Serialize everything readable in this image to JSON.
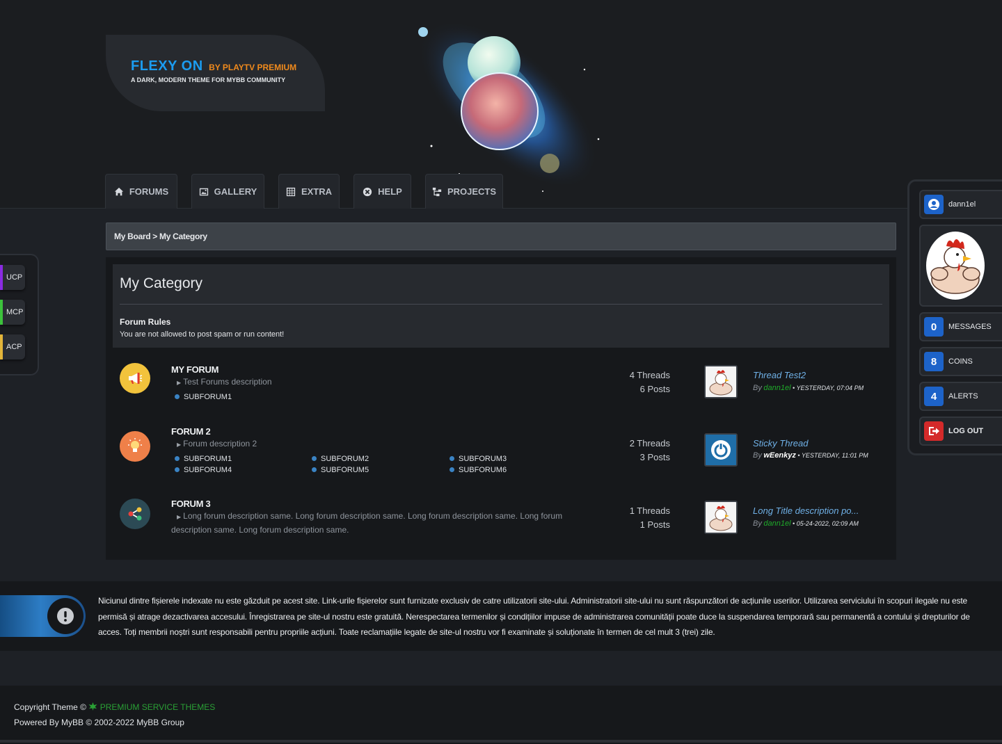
{
  "header": {
    "logo_main": "FLEXY ON",
    "logo_by": "BY PLAYTV PREMIUM",
    "logo_tagline": "A DARK, MODERN THEME FOR MYBB COMMUNITY"
  },
  "nav": {
    "tabs": [
      {
        "label": "FORUMS",
        "icon": "home-icon"
      },
      {
        "label": "GALLERY",
        "icon": "image-icon"
      },
      {
        "label": "EXTRA",
        "icon": "grid-icon"
      },
      {
        "label": "HELP",
        "icon": "help-icon"
      },
      {
        "label": "PROJECTS",
        "icon": "sitemap-icon"
      }
    ]
  },
  "left_panel": {
    "items": [
      {
        "label": "UCP",
        "color": "#8a2be2"
      },
      {
        "label": "MCP",
        "color": "#3cc23c"
      },
      {
        "label": "ACP",
        "color": "#e3b53a"
      }
    ]
  },
  "breadcrumb": {
    "root": "My Board",
    "separator": ">",
    "current": "My Category"
  },
  "category": {
    "title": "My Category",
    "rules_title": "Forum Rules",
    "rules_text": "You are not allowed to post spam or run content!",
    "forums": [
      {
        "name": "MY FORUM",
        "description": "Test Forums description",
        "icon": "megaphone-icon",
        "icon_color": "#f2c33c",
        "subforums": [
          "SUBFORUM1"
        ],
        "threads": "4 Threads",
        "posts": "6 Posts",
        "last_title": "Thread Test2",
        "last_by": "By",
        "last_user": "dann1el",
        "last_date": "• YESTERDAY, 07:04 PM"
      },
      {
        "name": "FORUM 2",
        "description": "Forum description 2",
        "icon": "lightbulb-icon",
        "icon_color": "#ef8049",
        "subforums": [
          "SUBFORUM1",
          "SUBFORUM2",
          "SUBFORUM3",
          "SUBFORUM4",
          "SUBFORUM5",
          "SUBFORUM6"
        ],
        "threads": "2 Threads",
        "posts": "3 Posts",
        "last_title": "Sticky Thread",
        "last_by": "By",
        "last_user": "wEenkyz",
        "last_date": "• YESTERDAY, 11:01 PM"
      },
      {
        "name": "FORUM 3",
        "description": "Long forum description same. Long forum description same. Long forum description same. Long forum description same. Long forum description same.",
        "icon": "share-icon",
        "icon_color": "#2c4a55",
        "subforums": [],
        "threads": "1 Threads",
        "posts": "1 Posts",
        "last_title": "Long Title description po...",
        "last_by": "By",
        "last_user": "dann1el",
        "last_date": "• 05-24-2022, 02:09 AM"
      }
    ]
  },
  "user_panel": {
    "username": "dann1el",
    "messages_count": "0",
    "messages_label": "MESSAGES",
    "coins_count": "8",
    "coins_label": "COINS",
    "alerts_count": "4",
    "alerts_label": "ALERTS",
    "logout_label": "LOG OUT"
  },
  "disclaimer": {
    "text": "Niciunul dintre fișierele indexate nu este găzduit pe acest site. Link-urile fișierelor sunt furnizate exclusiv de catre utilizatorii site-ului. Administratorii site-ului nu sunt răspunzători de acțiunile userilor. Utilizarea serviciului în scopuri ilegale nu este permisă și atrage dezactivarea accesului. Înregistrarea pe site-ul nostru este gratuită. Nerespectarea termenilor și condițiilor impuse de administrarea comunității poate duce la suspendarea temporară sau permanentă a contului și drepturilor de acces. Toți membrii noștri sunt responsabili pentru propriile acțiuni. Toate reclamațiile legate de site-ul nostru vor fi examinate și soluționate în termen de cel mult 3 (trei) zile."
  },
  "footer": {
    "copyright_prefix": "Copyright Theme ©",
    "copyright_link": "PREMIUM SERVICE THEMES",
    "powered_by": "Powered By MyBB © 2002-2022 MyBB Group"
  }
}
